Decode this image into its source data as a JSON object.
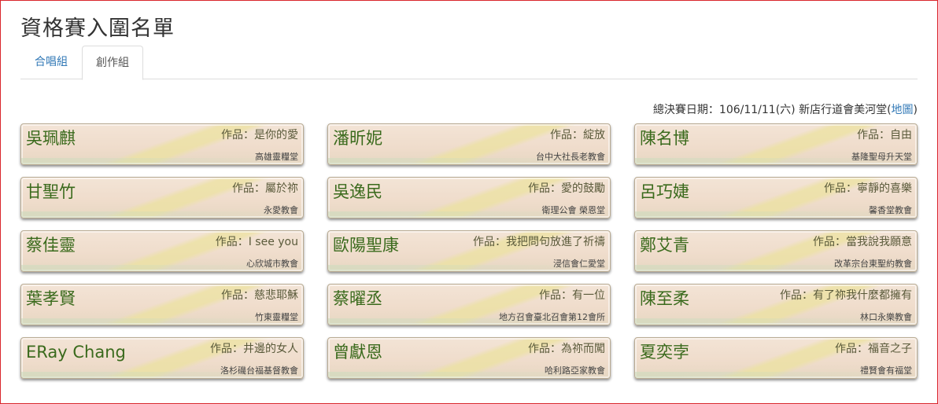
{
  "page": {
    "title": "資格賽入圍名單"
  },
  "tabs": [
    {
      "label": "合唱組",
      "active": false
    },
    {
      "label": "創作組",
      "active": true
    }
  ],
  "final": {
    "text": "總決賽日期：106/11/11(六) 新店行道會美河堂(",
    "map_link": "地圖",
    "close": ")"
  },
  "work_prefix": "作品：",
  "entries": [
    {
      "name": "吳珮麒",
      "work": "是你的愛",
      "church": "高雄靈糧堂"
    },
    {
      "name": "潘昕妮",
      "work": "綻放",
      "church": "台中大社長老教會"
    },
    {
      "name": "陳名博",
      "work": "自由",
      "church": "基隆聖母升天堂"
    },
    {
      "name": "甘聖竹",
      "work": "屬於祢",
      "church": "永愛教會"
    },
    {
      "name": "吳逸民",
      "work": "愛的鼓勵",
      "church": "衛理公會 榮恩堂"
    },
    {
      "name": "呂巧婕",
      "work": "寧靜的喜樂",
      "church": "馨香堂教會"
    },
    {
      "name": "蔡佳靈",
      "work": "I see you",
      "church": "心欣城市教會"
    },
    {
      "name": "歐陽聖康",
      "work": "我把問句放進了祈禱",
      "church": "浸信會仁愛堂"
    },
    {
      "name": "鄭艾青",
      "work": "當我說我願意",
      "church": "改革宗台東聖約教會"
    },
    {
      "name": "葉孝賢",
      "work": "慈悲耶穌",
      "church": "竹東靈糧堂"
    },
    {
      "name": "蔡曜丞",
      "work": "有一位",
      "church": "地方召會臺北召會第12會所"
    },
    {
      "name": "陳至柔",
      "work": "有了祢我什麼都擁有",
      "church": "林口永樂教會"
    },
    {
      "name": "ERay Chang",
      "work": "井邊的女人",
      "church": "洛杉磯台福基督教會"
    },
    {
      "name": "曾獻恩",
      "work": "為祢而闖",
      "church": "哈利路亞家教會"
    },
    {
      "name": "夏奕孛",
      "work": "福音之子",
      "church": "禮賢會有福堂"
    }
  ]
}
